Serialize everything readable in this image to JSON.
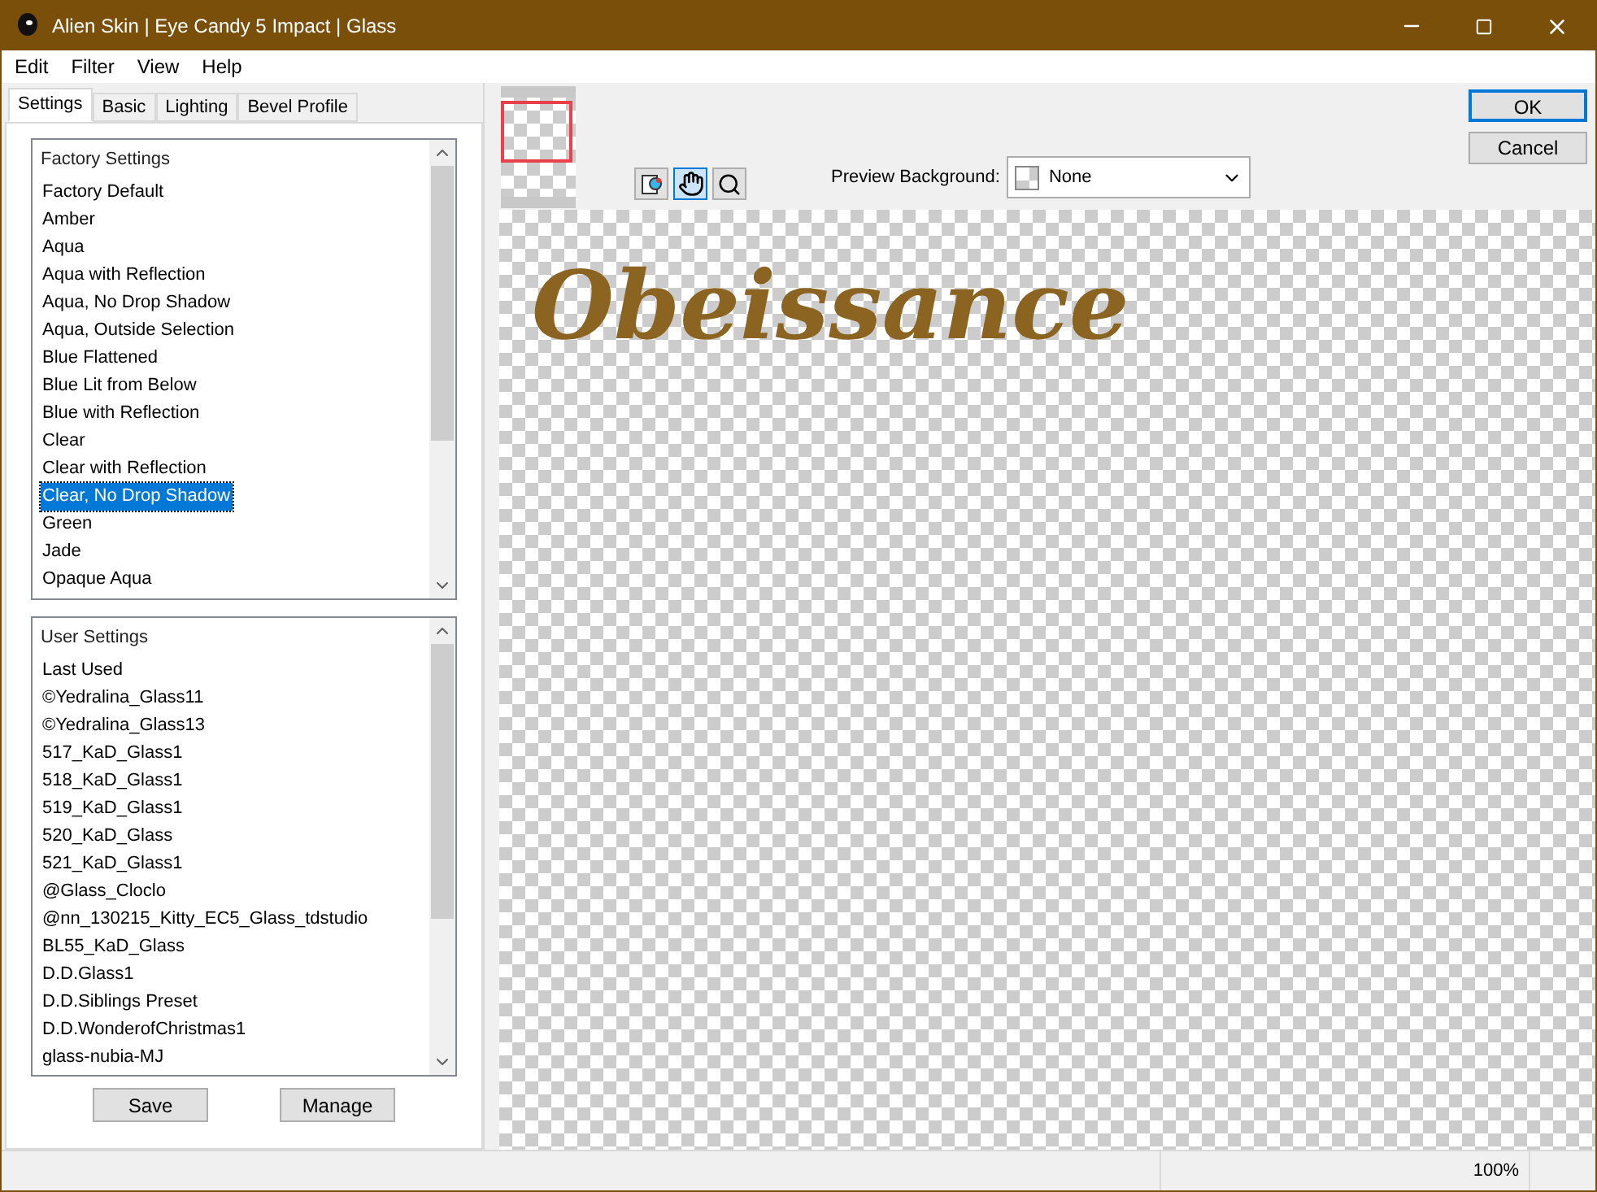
{
  "window": {
    "title": "Alien Skin | Eye Candy 5 Impact | Glass"
  },
  "menu": [
    "Edit",
    "Filter",
    "View",
    "Help"
  ],
  "tabs": [
    {
      "label": "Settings",
      "selected": true
    },
    {
      "label": "Basic",
      "selected": false
    },
    {
      "label": "Lighting",
      "selected": false
    },
    {
      "label": "Bevel Profile",
      "selected": false
    }
  ],
  "factory_settings": {
    "header": "Factory Settings",
    "items": [
      {
        "label": "Factory Default",
        "selected": false
      },
      {
        "label": "Amber",
        "selected": false
      },
      {
        "label": "Aqua",
        "selected": false
      },
      {
        "label": "Aqua with Reflection",
        "selected": false
      },
      {
        "label": "Aqua, No Drop Shadow",
        "selected": false
      },
      {
        "label": "Aqua, Outside Selection",
        "selected": false
      },
      {
        "label": "Blue Flattened",
        "selected": false
      },
      {
        "label": "Blue Lit from Below",
        "selected": false
      },
      {
        "label": "Blue with Reflection",
        "selected": false
      },
      {
        "label": "Clear",
        "selected": false
      },
      {
        "label": "Clear with Reflection",
        "selected": false
      },
      {
        "label": "Clear, No Drop Shadow",
        "selected": true
      },
      {
        "label": "Green",
        "selected": false
      },
      {
        "label": "Jade",
        "selected": false
      },
      {
        "label": "Opaque Aqua",
        "selected": false
      }
    ]
  },
  "user_settings": {
    "header": "User Settings",
    "items": [
      {
        "label": "Last Used",
        "selected": false
      },
      {
        "label": "©Yedralina_Glass11",
        "selected": false
      },
      {
        "label": "©Yedralina_Glass13",
        "selected": false
      },
      {
        "label": "517_KaD_Glass1",
        "selected": false
      },
      {
        "label": "518_KaD_Glass1",
        "selected": false
      },
      {
        "label": "519_KaD_Glass1",
        "selected": false
      },
      {
        "label": "520_KaD_Glass",
        "selected": false
      },
      {
        "label": "521_KaD_Glass1",
        "selected": false
      },
      {
        "label": "@Glass_Cloclo",
        "selected": false
      },
      {
        "label": "@nn_130215_Kitty_EC5_Glass_tdstudio",
        "selected": false
      },
      {
        "label": "BL55_KaD_Glass",
        "selected": false
      },
      {
        "label": "D.D.Glass1",
        "selected": false
      },
      {
        "label": "D.D.Siblings Preset",
        "selected": false
      },
      {
        "label": "D.D.WonderofChristmas1",
        "selected": false
      },
      {
        "label": "glass-nubia-MJ",
        "selected": false
      }
    ]
  },
  "settings_buttons": [
    "Save",
    "Manage"
  ],
  "tools": [
    {
      "kind": "preview",
      "selected": false
    },
    {
      "kind": "hand",
      "selected": true
    },
    {
      "kind": "zoom",
      "selected": false
    }
  ],
  "preview_background": {
    "label": "Preview Background:",
    "value": "None"
  },
  "dialog_buttons": [
    {
      "label": "OK",
      "default": true
    },
    {
      "label": "Cancel",
      "default": false
    }
  ],
  "preview_text": "Obeissance",
  "status_bar": {
    "zoom": "100%"
  }
}
